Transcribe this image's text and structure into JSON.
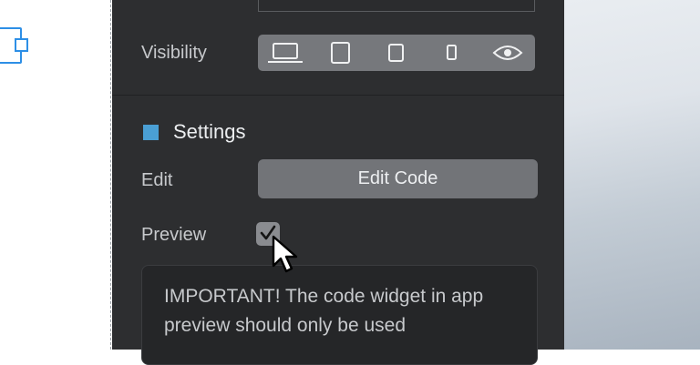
{
  "properties": {
    "visibility_label": "Visibility",
    "visibility_options": [
      {
        "icon": "laptop-icon",
        "selected": true
      },
      {
        "icon": "tablet-icon",
        "selected": false
      },
      {
        "icon": "tablet-small-icon",
        "selected": false
      },
      {
        "icon": "phone-icon",
        "selected": false
      },
      {
        "icon": "eye-icon",
        "selected": false
      }
    ]
  },
  "settings": {
    "title": "Settings",
    "accent_color": "#4a9fd4",
    "edit_label": "Edit",
    "edit_button": "Edit Code",
    "preview_label": "Preview",
    "preview_checked": true,
    "note": "IMPORTANT! The code widget in app preview should only be used"
  }
}
